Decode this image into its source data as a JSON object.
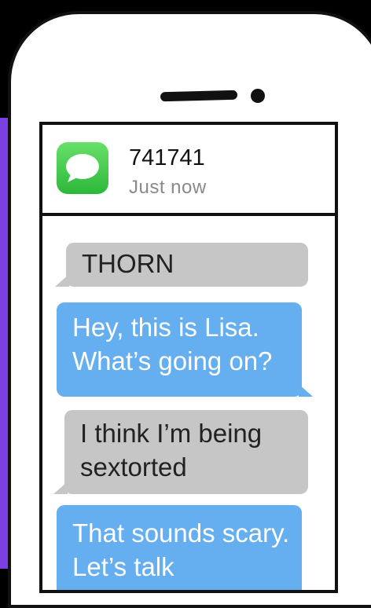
{
  "notification": {
    "app_icon": "messages-bubble-icon",
    "sender": "741741",
    "time": "Just now"
  },
  "messages": [
    {
      "direction": "incoming",
      "text": "THORN"
    },
    {
      "direction": "outgoing",
      "text": "Hey, this is Lisa. What’s going on?"
    },
    {
      "direction": "incoming",
      "text": "I think I’m being sextorted"
    },
    {
      "direction": "outgoing",
      "text": "That sounds scary. Let’s talk"
    }
  ],
  "colors": {
    "incoming_bubble": "#c6c6c6",
    "outgoing_bubble": "#65aef0",
    "background_accent": "#7b3fe4"
  }
}
